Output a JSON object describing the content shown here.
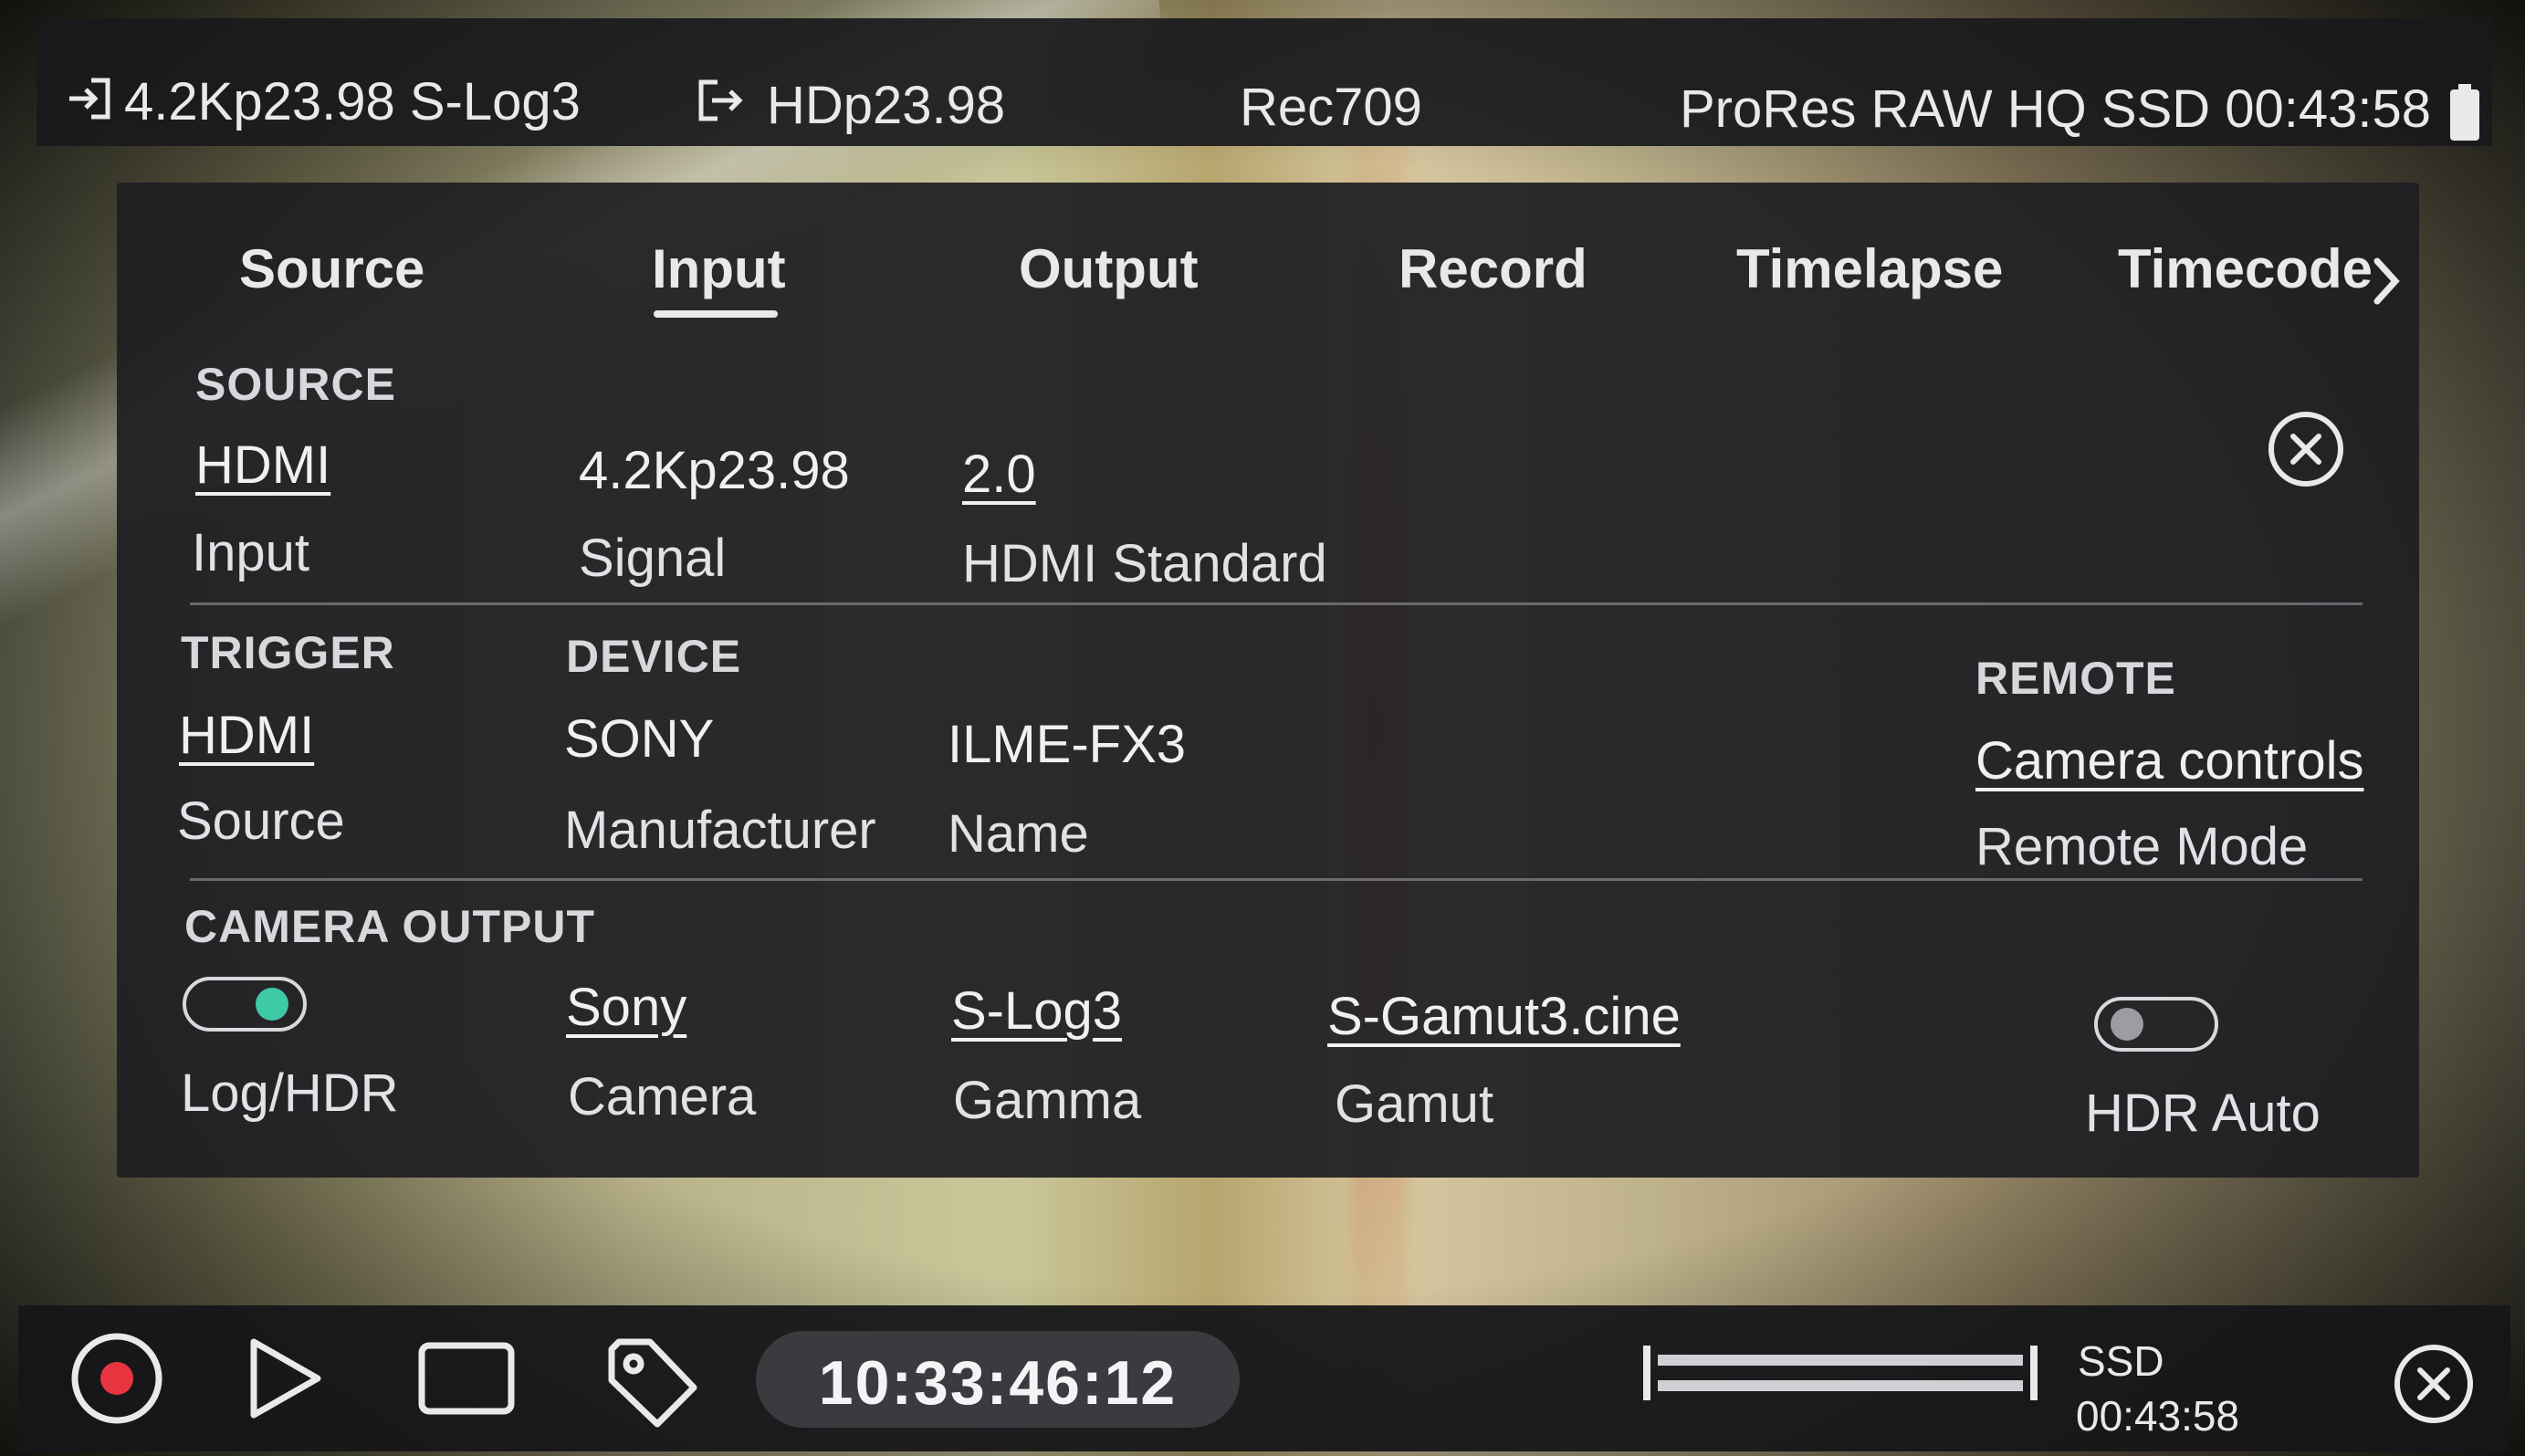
{
  "status_bar": {
    "input_format": "4.2Kp23.98 S-Log3",
    "output_format": "HDp23.98",
    "monitoring": "Rec709",
    "codec_media_time": "ProRes RAW HQ SSD 00:43:58"
  },
  "tabs": [
    {
      "label": "Source"
    },
    {
      "label": "Input",
      "active": true
    },
    {
      "label": "Output"
    },
    {
      "label": "Record"
    },
    {
      "label": "Timelapse"
    },
    {
      "label": "Timecode"
    }
  ],
  "source": {
    "heading": "SOURCE",
    "input_value": "HDMI",
    "input_label": "Input",
    "signal_value": "4.2Kp23.98",
    "signal_label": "Signal",
    "hdmi_standard_value": "2.0",
    "hdmi_standard_label": "HDMI Standard"
  },
  "trigger": {
    "heading": "TRIGGER",
    "source_value": "HDMI",
    "source_label": "Source"
  },
  "device": {
    "heading": "DEVICE",
    "manufacturer_value": "SONY",
    "manufacturer_label": "Manufacturer",
    "name_value": "ILME-FX3",
    "name_label": "Name"
  },
  "remote": {
    "heading": "REMOTE",
    "mode_value": "Camera controls",
    "mode_label": "Remote Mode"
  },
  "camera_output": {
    "heading": "CAMERA OUTPUT",
    "log_hdr_label": "Log/HDR",
    "log_hdr_on": true,
    "camera_value": "Sony",
    "camera_label": "Camera",
    "gamma_value": "S-Log3",
    "gamma_label": "Gamma",
    "gamut_value": "S-Gamut3.cine",
    "gamut_label": "Gamut",
    "hdr_auto_label": "HDR Auto",
    "hdr_auto_on": false
  },
  "bottom_bar": {
    "timecode": "10:33:46:12",
    "storage_label": "SSD",
    "storage_time": "00:43:58"
  },
  "colors": {
    "toggle_on": "#3ec9a7",
    "toggle_off_knob": "#9c9ca2",
    "record_dot": "#e8343f",
    "panel_bg": "#1e1e22"
  },
  "icons": [
    "input-icon",
    "output-icon",
    "battery-icon",
    "chevron-right-icon",
    "close-icon",
    "record-icon",
    "play-icon",
    "stop-icon",
    "tag-icon",
    "level-meter-icon"
  ]
}
